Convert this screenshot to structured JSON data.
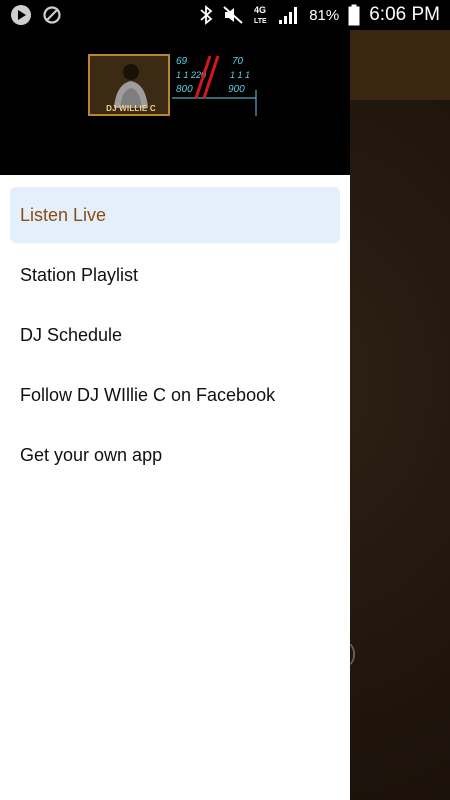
{
  "status_bar": {
    "battery_percent": "81%",
    "time": "6:06 PM",
    "network": "4G LTE",
    "icons": [
      "play-icon",
      "no-sync-icon",
      "bluetooth-icon",
      "mute-icon",
      "network-4g-icon",
      "signal-icon",
      "battery-icon"
    ]
  },
  "drawer": {
    "logo": {
      "caption": "DJ WILLIE C"
    },
    "menu": [
      {
        "label": "Listen Live",
        "active": true
      },
      {
        "label": "Station Playlist",
        "active": false
      },
      {
        "label": "DJ Schedule",
        "active": false
      },
      {
        "label": "Follow DJ WIllie C on Facebook",
        "active": false
      },
      {
        "label": "Get your own app",
        "active": false
      }
    ]
  },
  "background_app": {
    "peek_text": "t)"
  },
  "colors": {
    "active_text": "#8a4c12",
    "active_bg": "#e3f0fb",
    "toolbar": "#3a2711"
  }
}
